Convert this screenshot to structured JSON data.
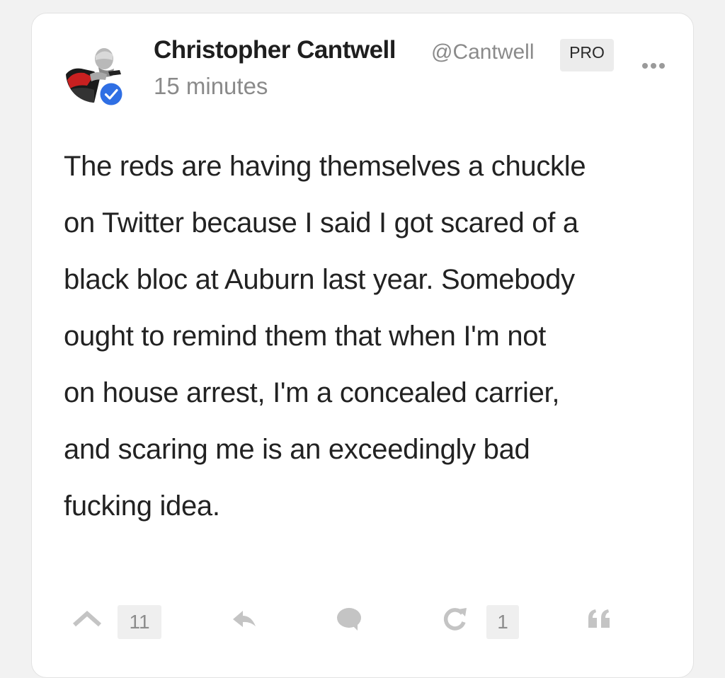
{
  "post": {
    "author": {
      "name": "Christopher Cantwell",
      "handle": "@Cantwell",
      "badge": "PRO",
      "verified": true
    },
    "timestamp": "15 minutes",
    "lines": [
      "The reds are having themselves a chuckle",
      "on Twitter because I said I got scared of a",
      "black bloc at Auburn last year. Somebody",
      "ought to remind them that when I'm not",
      "on house arrest, I'm a concealed carrier,",
      "and scaring me is an exceedingly bad",
      "fucking idea."
    ],
    "actions": {
      "upvote_icon": "chevron-up-icon",
      "upvote_count": "11",
      "reply_icon": "reply-icon",
      "comment_icon": "comment-bubble-icon",
      "repost_icon": "repost-icon",
      "repost_count": "1",
      "quote_icon": "quote-icon"
    }
  },
  "colors": {
    "verified_badge": "#2f6fe4",
    "icon_grey": "#c4c4c4"
  }
}
